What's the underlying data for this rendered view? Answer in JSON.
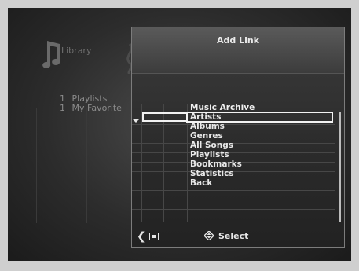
{
  "background": {
    "section_title": "Library",
    "list": [
      {
        "num": "1",
        "label": "Playlists"
      },
      {
        "num": "1",
        "label": "My Favorite"
      }
    ]
  },
  "dialog": {
    "title": "Add Link",
    "menu_title": "Music Archive",
    "items": [
      "Artists",
      "Albums",
      "Genres",
      "All Songs",
      "Playlists",
      "Bookmarks",
      "Statistics",
      "Back"
    ],
    "selected_index": 0
  },
  "footer": {
    "select_label": "Select"
  },
  "icons": {
    "library": "music-note-icon",
    "back": "chevron-left-icon",
    "back_key": "back-key-icon",
    "select": "navigation-diamond-icon",
    "dropdown": "triangle-down-icon"
  },
  "colors": {
    "background": "#2c2c2c",
    "dialog": "#2a2a2a",
    "text": "#e8e8e8",
    "dim_text": "#8b8b8b",
    "highlight": "#f2f2f2"
  }
}
